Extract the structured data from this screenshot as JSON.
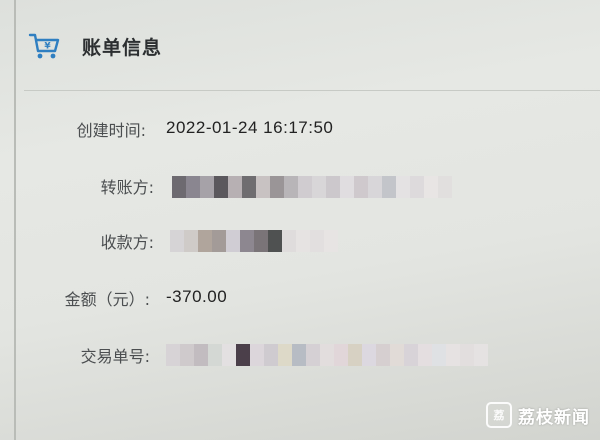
{
  "header": {
    "title": "账单信息",
    "icon": "cart-icon"
  },
  "fields": {
    "created_time": {
      "label": "创建时间:",
      "value": "2022-01-24 16:17:50"
    },
    "payer": {
      "label": "转账方:"
    },
    "payee": {
      "label": "收款方:"
    },
    "amount": {
      "label": "金额（元）:",
      "value": "-370.00"
    },
    "transaction_id": {
      "label": "交易单号:"
    }
  },
  "watermark": {
    "text": "荔枝新闻"
  },
  "colors": {
    "icon_blue": "#2f7fc1",
    "background": "#e3e5e1"
  }
}
